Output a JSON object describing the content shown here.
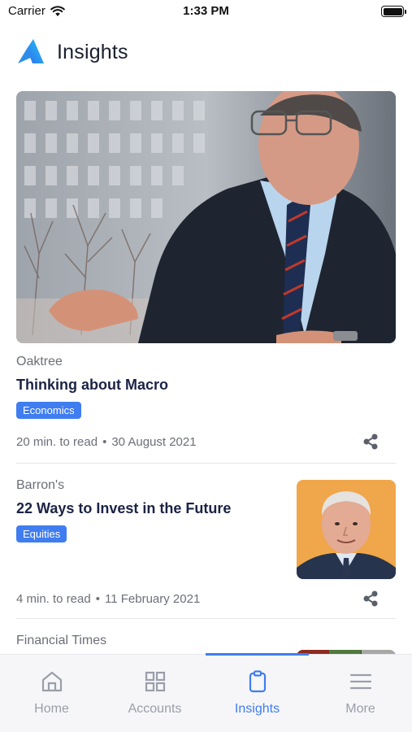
{
  "status_bar": {
    "carrier": "Carrier",
    "time": "1:33 PM"
  },
  "header": {
    "title": "Insights"
  },
  "articles": [
    {
      "source": "Oaktree",
      "title": "Thinking about Macro",
      "tag": "Economics",
      "read_time": "20 min. to read",
      "date": "30 August 2021"
    },
    {
      "source": "Barron's",
      "title": "22 Ways to Invest in the Future",
      "tag": "Equities",
      "read_time": "4 min. to read",
      "date": "11 February 2021"
    },
    {
      "source": "Financial Times"
    }
  ],
  "tab_bar": {
    "tabs": [
      {
        "label": "Home",
        "icon": "home-icon"
      },
      {
        "label": "Accounts",
        "icon": "grid-icon"
      },
      {
        "label": "Insights",
        "icon": "clipboard-icon"
      },
      {
        "label": "More",
        "icon": "menu-icon"
      }
    ],
    "active_index": 2
  },
  "colors": {
    "accent": "#3f7df0",
    "title": "#1b2345",
    "muted": "#6b6f78",
    "tab_inactive": "#9a9ea8"
  }
}
